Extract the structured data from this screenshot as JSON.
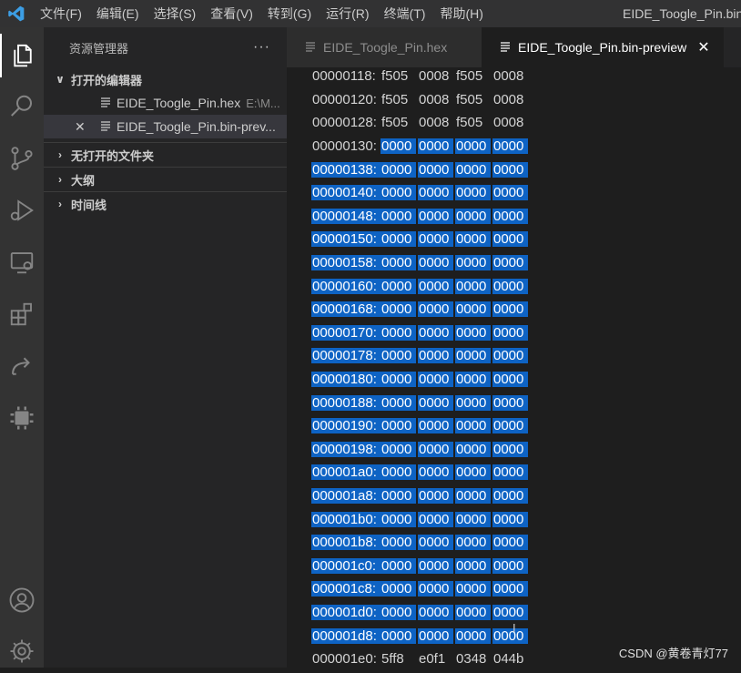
{
  "menu": {
    "logo": "vscode-logo-icon",
    "items": [
      "文件(F)",
      "编辑(E)",
      "选择(S)",
      "查看(V)",
      "转到(G)",
      "运行(R)",
      "终端(T)",
      "帮助(H)"
    ],
    "window_title": "EIDE_Toogle_Pin.bin-"
  },
  "activity_bar": {
    "icons": [
      "files-icon",
      "search-icon",
      "source-control-icon",
      "run-debug-icon",
      "remote-explorer-icon",
      "extensions-icon",
      "share-icon",
      "chip-icon",
      "account-icon",
      "settings-gear-icon"
    ]
  },
  "sidebar": {
    "title": "资源管理器",
    "more": "···",
    "open_editors": {
      "label": "打开的编辑器",
      "items": [
        {
          "name": "EIDE_Toogle_Pin.hex",
          "path": "E:\\M..."
        },
        {
          "name": "EIDE_Toogle_Pin.bin-prev...",
          "path": ""
        }
      ]
    },
    "sections": [
      "无打开的文件夹",
      "大纲",
      "时间线"
    ]
  },
  "tabs": [
    {
      "label": "EIDE_Toogle_Pin.hex",
      "active": false
    },
    {
      "label": "EIDE_Toogle_Pin.bin-preview",
      "active": true
    }
  ],
  "editor": {
    "rows": [
      {
        "addr": "00000118:",
        "cells": [
          "f505",
          "0008",
          "f505",
          "0008"
        ],
        "selected": false
      },
      {
        "addr": "00000120:",
        "cells": [
          "f505",
          "0008",
          "f505",
          "0008"
        ],
        "selected": false
      },
      {
        "addr": "00000128:",
        "cells": [
          "f505",
          "0008",
          "f505",
          "0008"
        ],
        "selected": false
      },
      {
        "addr": "00000130:",
        "cells": [
          "0000",
          "0000",
          "0000",
          "0000"
        ],
        "selected": "cells"
      },
      {
        "addr": "00000138:",
        "cells": [
          "0000",
          "0000",
          "0000",
          "0000"
        ],
        "selected": true
      },
      {
        "addr": "00000140:",
        "cells": [
          "0000",
          "0000",
          "0000",
          "0000"
        ],
        "selected": true
      },
      {
        "addr": "00000148:",
        "cells": [
          "0000",
          "0000",
          "0000",
          "0000"
        ],
        "selected": true
      },
      {
        "addr": "00000150:",
        "cells": [
          "0000",
          "0000",
          "0000",
          "0000"
        ],
        "selected": true
      },
      {
        "addr": "00000158:",
        "cells": [
          "0000",
          "0000",
          "0000",
          "0000"
        ],
        "selected": true
      },
      {
        "addr": "00000160:",
        "cells": [
          "0000",
          "0000",
          "0000",
          "0000"
        ],
        "selected": true
      },
      {
        "addr": "00000168:",
        "cells": [
          "0000",
          "0000",
          "0000",
          "0000"
        ],
        "selected": true
      },
      {
        "addr": "00000170:",
        "cells": [
          "0000",
          "0000",
          "0000",
          "0000"
        ],
        "selected": true
      },
      {
        "addr": "00000178:",
        "cells": [
          "0000",
          "0000",
          "0000",
          "0000"
        ],
        "selected": true
      },
      {
        "addr": "00000180:",
        "cells": [
          "0000",
          "0000",
          "0000",
          "0000"
        ],
        "selected": true
      },
      {
        "addr": "00000188:",
        "cells": [
          "0000",
          "0000",
          "0000",
          "0000"
        ],
        "selected": true
      },
      {
        "addr": "00000190:",
        "cells": [
          "0000",
          "0000",
          "0000",
          "0000"
        ],
        "selected": true
      },
      {
        "addr": "00000198:",
        "cells": [
          "0000",
          "0000",
          "0000",
          "0000"
        ],
        "selected": true
      },
      {
        "addr": "000001a0:",
        "cells": [
          "0000",
          "0000",
          "0000",
          "0000"
        ],
        "selected": true
      },
      {
        "addr": "000001a8:",
        "cells": [
          "0000",
          "0000",
          "0000",
          "0000"
        ],
        "selected": true
      },
      {
        "addr": "000001b0:",
        "cells": [
          "0000",
          "0000",
          "0000",
          "0000"
        ],
        "selected": true
      },
      {
        "addr": "000001b8:",
        "cells": [
          "0000",
          "0000",
          "0000",
          "0000"
        ],
        "selected": true
      },
      {
        "addr": "000001c0:",
        "cells": [
          "0000",
          "0000",
          "0000",
          "0000"
        ],
        "selected": true
      },
      {
        "addr": "000001c8:",
        "cells": [
          "0000",
          "0000",
          "0000",
          "0000"
        ],
        "selected": true
      },
      {
        "addr": "000001d0:",
        "cells": [
          "0000",
          "0000",
          "0000",
          "0000"
        ],
        "selected": true
      },
      {
        "addr": "000001d8:",
        "cells": [
          "0000",
          "0000",
          "0000",
          "0000"
        ],
        "selected": true
      },
      {
        "addr": "000001e0:",
        "cells": [
          "5ff8",
          "e0f1",
          "0348",
          "044b"
        ],
        "selected": false
      }
    ]
  },
  "colors": {
    "selection": "#0e63c4",
    "activity_bar": "#333333",
    "sidebar": "#252526",
    "editor": "#1e1e1e"
  },
  "watermark": "CSDN @黄卷青灯77"
}
